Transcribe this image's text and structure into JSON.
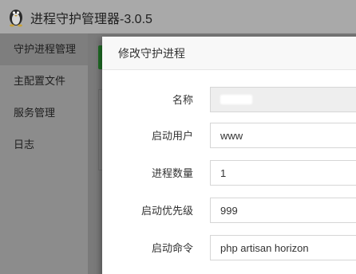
{
  "app": {
    "title": "进程守护管理器-3.0.5"
  },
  "sidebar": {
    "items": [
      {
        "label": "守护进程管理"
      },
      {
        "label": "主配置文件"
      },
      {
        "label": "服务管理"
      },
      {
        "label": "日志"
      }
    ]
  },
  "modal": {
    "title": "修改守护进程",
    "fields": [
      {
        "label": "名称",
        "value": ""
      },
      {
        "label": "启动用户",
        "value": "www"
      },
      {
        "label": "进程数量",
        "value": "1"
      },
      {
        "label": "启动优先级",
        "value": "999"
      },
      {
        "label": "启动命令",
        "value": "php artisan horizon"
      }
    ]
  },
  "colors": {
    "overlay_dim": "#5f5f5f",
    "accent_green": "#1f6e25",
    "modal_bg": "#ffffff"
  }
}
